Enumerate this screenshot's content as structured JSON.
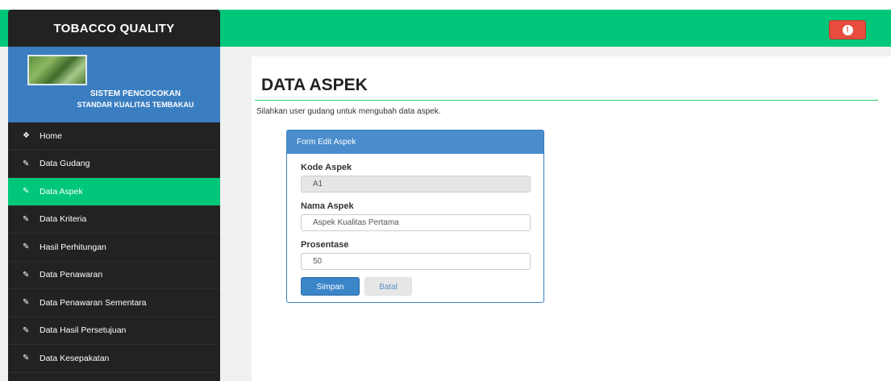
{
  "brand": {
    "title": "TOBACCO QUALITY"
  },
  "navbar": {
    "alert_icon": "exclamation-icon",
    "alert_glyph": "!",
    "accent": "#00c77a"
  },
  "profile": {
    "line1": "SISTEM PENCOCOKAN",
    "line2": "STANDAR KUALITAS TEMBAKAU"
  },
  "sidebar": {
    "items": [
      {
        "label": "Home",
        "icon": "home-icon",
        "glyph": "❖"
      },
      {
        "label": "Data Gudang",
        "icon": "pencil-icon",
        "glyph": "✎"
      },
      {
        "label": "Data Aspek",
        "icon": "pencil-icon",
        "glyph": "✎"
      },
      {
        "label": "Data Kriteria",
        "icon": "pencil-icon",
        "glyph": "✎"
      },
      {
        "label": "Hasil Perhitungan",
        "icon": "pencil-icon",
        "glyph": "✎"
      },
      {
        "label": "Data Penawaran",
        "icon": "pencil-icon",
        "glyph": "✎"
      },
      {
        "label": "Data Penawaran Sementara",
        "icon": "pencil-icon",
        "glyph": "✎"
      },
      {
        "label": "Data Hasil Persetujuan",
        "icon": "pencil-icon",
        "glyph": "✎"
      },
      {
        "label": "Data Kesepakatan",
        "icon": "pencil-icon",
        "glyph": "✎"
      }
    ],
    "active_index": 2
  },
  "main": {
    "title": "DATA ASPEK",
    "subtitle": "Silahkan user gudang untuk mengubah data aspek.",
    "panel": {
      "heading": "Form Edit Aspek",
      "fields": {
        "kode": {
          "label": "Kode Aspek",
          "value": "A1"
        },
        "nama": {
          "label": "Nama Aspek",
          "value": "Aspek Kualitas Pertama"
        },
        "prosentase": {
          "label": "Prosentase",
          "value": "50"
        }
      },
      "save_label": "Simpan",
      "cancel_label": "Batal"
    }
  }
}
